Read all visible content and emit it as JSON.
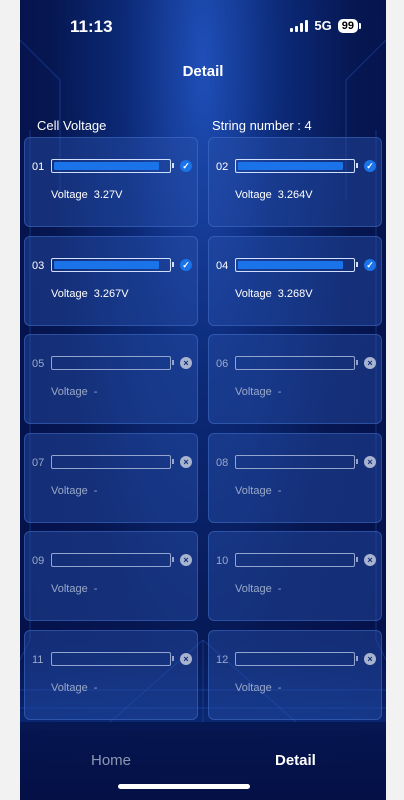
{
  "status_bar": {
    "time": "11:13",
    "network": "5G",
    "battery": "99"
  },
  "header": {
    "title": "Detail"
  },
  "labels": {
    "left": "Cell Voltage",
    "right": "String number : 4"
  },
  "cells": [
    {
      "num": "01",
      "label": "Voltage",
      "value": "3.27V",
      "active": true,
      "fill": 0.92
    },
    {
      "num": "02",
      "label": "Voltage",
      "value": "3.264V",
      "active": true,
      "fill": 0.92
    },
    {
      "num": "03",
      "label": "Voltage",
      "value": "3.267V",
      "active": true,
      "fill": 0.92
    },
    {
      "num": "04",
      "label": "Voltage",
      "value": "3.268V",
      "active": true,
      "fill": 0.92
    },
    {
      "num": "05",
      "label": "Voltage",
      "value": "-",
      "active": false,
      "fill": 0
    },
    {
      "num": "06",
      "label": "Voltage",
      "value": "-",
      "active": false,
      "fill": 0
    },
    {
      "num": "07",
      "label": "Voltage",
      "value": "-",
      "active": false,
      "fill": 0
    },
    {
      "num": "08",
      "label": "Voltage",
      "value": "-",
      "active": false,
      "fill": 0
    },
    {
      "num": "09",
      "label": "Voltage",
      "value": "-",
      "active": false,
      "fill": 0
    },
    {
      "num": "10",
      "label": "Voltage",
      "value": "-",
      "active": false,
      "fill": 0
    },
    {
      "num": "11",
      "label": "Voltage",
      "value": "-",
      "active": false,
      "fill": 0
    },
    {
      "num": "12",
      "label": "Voltage",
      "value": "-",
      "active": false,
      "fill": 0
    }
  ],
  "tabs": {
    "home": "Home",
    "detail": "Detail"
  },
  "colors": {
    "accent": "#1a73e8",
    "background": "#061650",
    "inactive": "#9aa9c9"
  }
}
